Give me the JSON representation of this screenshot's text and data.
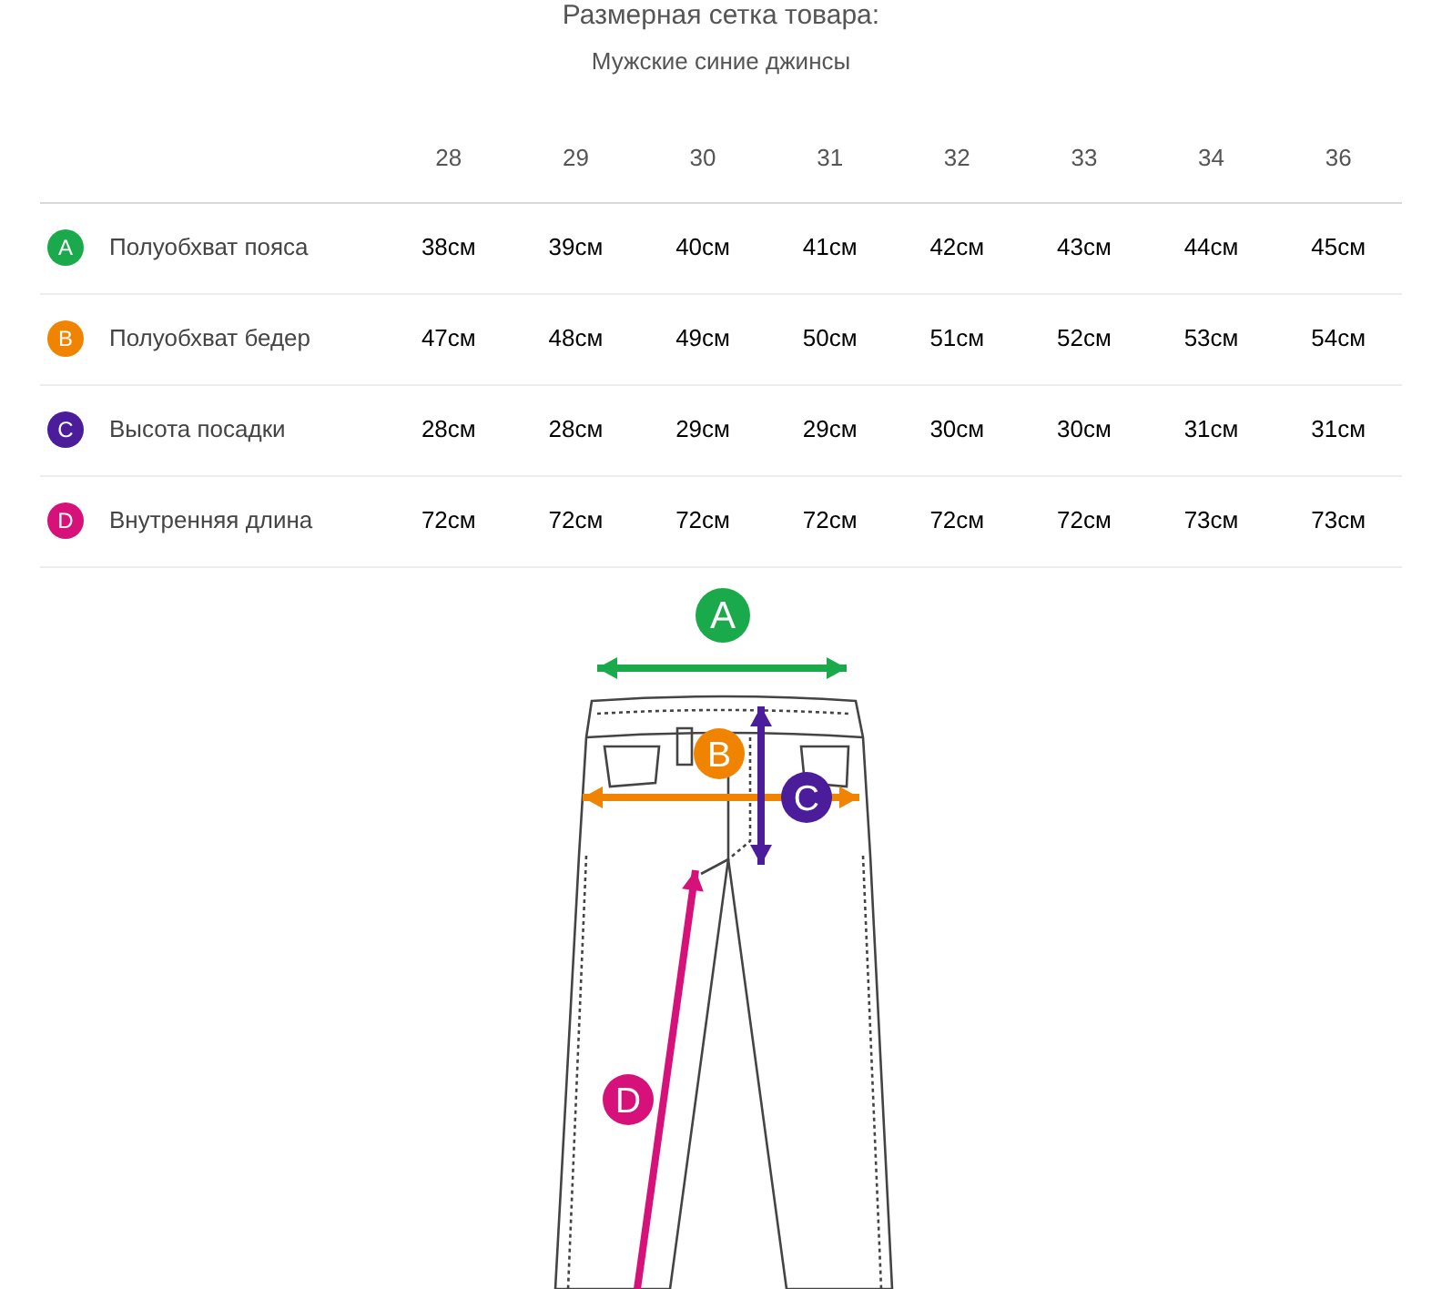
{
  "title": "Размерная сетка товара:",
  "subtitle": "Мужские синие джинсы",
  "sizes": [
    "28",
    "29",
    "30",
    "31",
    "32",
    "33",
    "34",
    "36"
  ],
  "measurements": [
    {
      "letter": "A",
      "color": "#1aaa4b",
      "label": "Полуобхват пояса",
      "values": [
        "38см",
        "39см",
        "40см",
        "41см",
        "42см",
        "43см",
        "44см",
        "45см"
      ]
    },
    {
      "letter": "B",
      "color": "#f08300",
      "label": "Полуобхват бедер",
      "values": [
        "47см",
        "48см",
        "49см",
        "50см",
        "51см",
        "52см",
        "53см",
        "54см"
      ]
    },
    {
      "letter": "C",
      "color": "#4b1d9a",
      "label": "Высота посадки",
      "values": [
        "28см",
        "28см",
        "29см",
        "29см",
        "30см",
        "30см",
        "31см",
        "31см"
      ]
    },
    {
      "letter": "D",
      "color": "#d6127a",
      "label": "Внутренняя длина",
      "values": [
        "72см",
        "72см",
        "72см",
        "72см",
        "72см",
        "72см",
        "73см",
        "73см"
      ]
    }
  ],
  "diagram_markers": [
    {
      "letter": "A",
      "color": "#1aaa4b",
      "kind": "horizontal"
    },
    {
      "letter": "B",
      "color": "#f08300",
      "kind": "horizontal"
    },
    {
      "letter": "C",
      "color": "#4b1d9a",
      "kind": "vertical"
    },
    {
      "letter": "D",
      "color": "#d6127a",
      "kind": "diagonal"
    }
  ]
}
